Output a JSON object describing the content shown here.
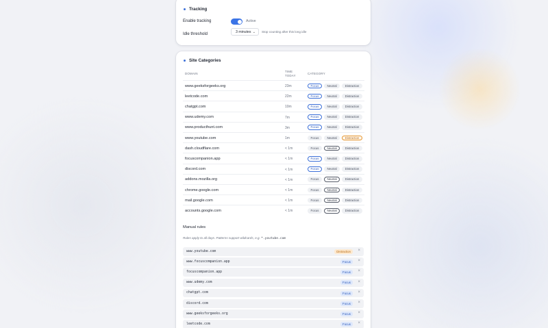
{
  "tracking": {
    "title": "Tracking",
    "enable_label": "Enable tracking",
    "toggle_state": "Active",
    "idle_label": "Idle threshold",
    "idle_value": "3 minutes",
    "idle_hint": "Stop counting after this long idle"
  },
  "sites": {
    "title": "Site Categories",
    "headers": {
      "domain": "DOMAIN",
      "time_1": "TIME",
      "time_2": "TODAY",
      "category": "CATEGORY"
    },
    "category_options": [
      "Focus",
      "Neutral",
      "Distraction"
    ],
    "rows": [
      {
        "domain": "www.geeksforgeeks.org",
        "time": "23m",
        "selected": "Focus"
      },
      {
        "domain": "leetcode.com",
        "time": "22m",
        "selected": "Focus"
      },
      {
        "domain": "chatgpt.com",
        "time": "10m",
        "selected": "Focus"
      },
      {
        "domain": "www.udemy.com",
        "time": "7m",
        "selected": "Focus"
      },
      {
        "domain": "www.producthunt.com",
        "time": "3m",
        "selected": "Focus"
      },
      {
        "domain": "www.youtube.com",
        "time": "1m",
        "selected": "Distraction"
      },
      {
        "domain": "dash.cloudflare.com",
        "time": "< 1m",
        "selected": "Neutral"
      },
      {
        "domain": "focuscompanion.app",
        "time": "< 1m",
        "selected": "Focus"
      },
      {
        "domain": "discord.com",
        "time": "< 1m",
        "selected": "Focus"
      },
      {
        "domain": "addons.mozilla.org",
        "time": "< 1m",
        "selected": "Neutral"
      },
      {
        "domain": "chrome.google.com",
        "time": "< 1m",
        "selected": "Neutral"
      },
      {
        "domain": "mail.google.com",
        "time": "< 1m",
        "selected": "Neutral"
      },
      {
        "domain": "accounts.google.com",
        "time": "< 1m",
        "selected": "Neutral"
      }
    ]
  },
  "manual_rules": {
    "title": "Manual rules",
    "hint_text": "Rules apply to all days. Patterns support wildcards, e.g.",
    "hint_example": "*.youtube.com",
    "remove_symbol": "×",
    "rules": [
      {
        "pattern": "www.youtube.com",
        "category": "Distraction"
      },
      {
        "pattern": "www.focuscompanion.app",
        "category": "Focus"
      },
      {
        "pattern": "focuscompanion.app",
        "category": "Focus"
      },
      {
        "pattern": "www.udemy.com",
        "category": "Focus"
      },
      {
        "pattern": "chatgpt.com",
        "category": "Focus"
      },
      {
        "pattern": "discord.com",
        "category": "Focus"
      },
      {
        "pattern": "www.geeksforgeeks.org",
        "category": "Focus"
      },
      {
        "pattern": "leetcode.com",
        "category": "Focus"
      }
    ]
  }
}
